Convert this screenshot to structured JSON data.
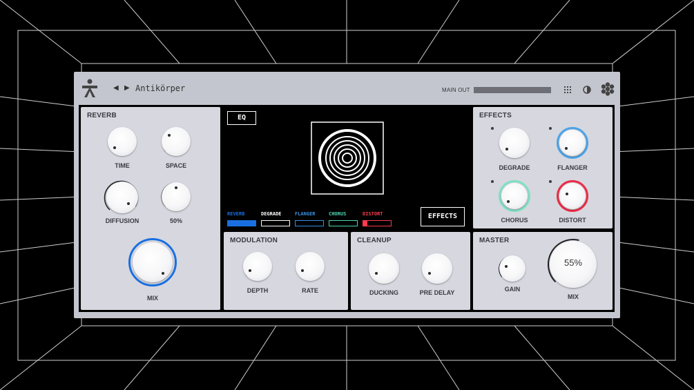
{
  "header": {
    "preset_name": "Antikörper",
    "prev_arrow": "◀",
    "next_arrow": "▶",
    "main_out_label": "MAIN OUT",
    "main_out_level": 1.0,
    "icons": [
      "logo-icon",
      "grid-icon",
      "contrast-icon",
      "flower-menu-icon"
    ]
  },
  "reverb": {
    "title": "REVERB",
    "time_label": "TIME",
    "space_label": "SPACE",
    "diffusion_label": "DIFFUSION",
    "fourth_label": "50%",
    "mix_label": "MIX"
  },
  "display": {
    "eq_label": "EQ",
    "effects_label": "EFFECTS",
    "chain": [
      {
        "label": "REVERB",
        "color": "#1a6fe0",
        "fill": 1.0
      },
      {
        "label": "DEGRADE",
        "color": "#ffffff",
        "fill": 0.0
      },
      {
        "label": "FLANGER",
        "color": "#3a90e0",
        "fill": 0.0
      },
      {
        "label": "CHORUS",
        "color": "#4fd6b0",
        "fill": 0.0
      },
      {
        "label": "DISTORT",
        "color": "#ff3b4e",
        "fill": 0.15
      }
    ]
  },
  "effects": {
    "title": "EFFECTS",
    "degrade_label": "DEGRADE",
    "flanger_label": "FLANGER",
    "chorus_label": "CHORUS",
    "distort_label": "DISTORT",
    "flanger_color": "#4aa3e8",
    "chorus_color": "#7fe0c2",
    "distort_color": "#ee2a44"
  },
  "modulation": {
    "title": "MODULATION",
    "depth_label": "DEPTH",
    "rate_label": "RATE"
  },
  "cleanup": {
    "title": "CLEANUP",
    "ducking_label": "DUCKING",
    "predelay_label": "PRE DELAY"
  },
  "master": {
    "title": "MASTER",
    "gain_label": "GAIN",
    "mix_label": "MIX",
    "mix_value": "55%",
    "mix_level": 0.55
  },
  "accent_blue": "#1a6fe0"
}
